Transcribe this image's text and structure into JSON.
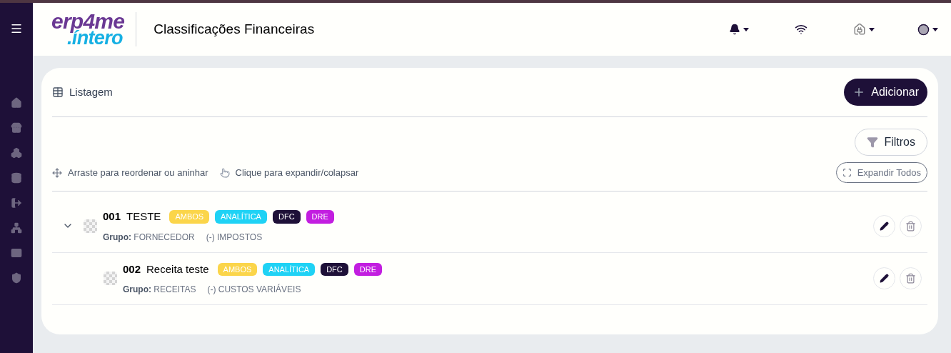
{
  "header": {
    "logo": {
      "top": "erp4me",
      "bottom": ".íntero"
    },
    "title": "Classificações Financeiras"
  },
  "card": {
    "title": "Listagem",
    "add_button": "Adicionar",
    "filter_button": "Filtros",
    "hints": [
      "Arraste para reordenar ou aninhar",
      "Clique para expandir/colapsar"
    ],
    "expand_all_button": "Expandir Todos"
  },
  "tree": [
    {
      "code": "001",
      "name": "TESTE",
      "expanded": true,
      "tags": [
        {
          "label": "AMBOS",
          "color": "#fbd54a"
        },
        {
          "label": "ANALÍTICA",
          "color": "#1fd2f5"
        },
        {
          "label": "DFC",
          "color": "#1e1038"
        },
        {
          "label": "DRE",
          "color": "#c21ee0"
        }
      ],
      "group_label": "Grupo:",
      "group": "FORNECEDOR",
      "category": "(-) IMPOSTOS",
      "children": [
        {
          "code": "002",
          "name": "Receita teste",
          "tags": [
            {
              "label": "AMBOS",
              "color": "#fbd54a"
            },
            {
              "label": "ANALÍTICA",
              "color": "#1fd2f5"
            },
            {
              "label": "DFC",
              "color": "#1e1038"
            },
            {
              "label": "DRE",
              "color": "#c21ee0"
            }
          ],
          "group_label": "Grupo:",
          "group": "RECEITAS",
          "category": "(-) CUSTOS VARIÁVEIS"
        }
      ]
    }
  ]
}
